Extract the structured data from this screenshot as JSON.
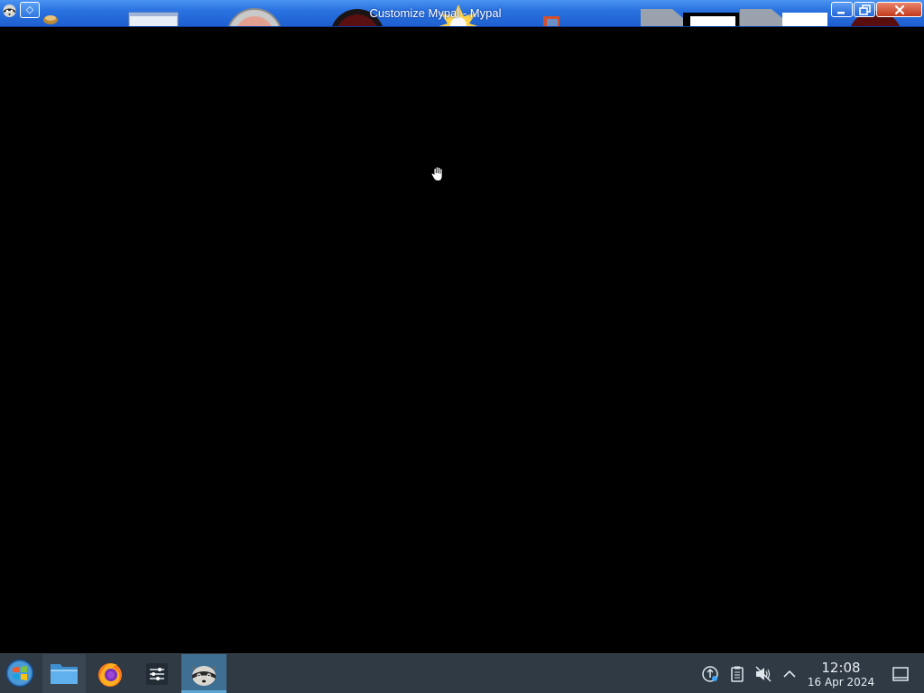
{
  "window": {
    "title": "Customize Mypal - Mypal",
    "menu_glyph": "◇",
    "buttons": [
      "minimize-icon",
      "maximize-icon",
      "close-icon"
    ]
  },
  "content": {
    "background": "#000000",
    "cursor": "hand-cursor-icon"
  },
  "taskbar": {
    "start": "start-orb-icon",
    "pinned": [
      {
        "name": "file-manager-icon",
        "active": false
      },
      {
        "name": "firefox-icon",
        "active": false
      },
      {
        "name": "settings-sliders-icon",
        "active": false
      },
      {
        "name": "mypal-raccoon-icon",
        "active": true
      }
    ],
    "tray": [
      "updates-icon",
      "clipboard-icon",
      "volume-muted-icon",
      "chevron-up-icon"
    ],
    "clock": {
      "time": "12:08",
      "date": "16 Apr 2024"
    },
    "show_desktop": "show-desktop-icon"
  },
  "colors": {
    "titlebar": "#2a72e0",
    "taskbar": "#2f3a44",
    "active_task": "#3f6f93"
  }
}
